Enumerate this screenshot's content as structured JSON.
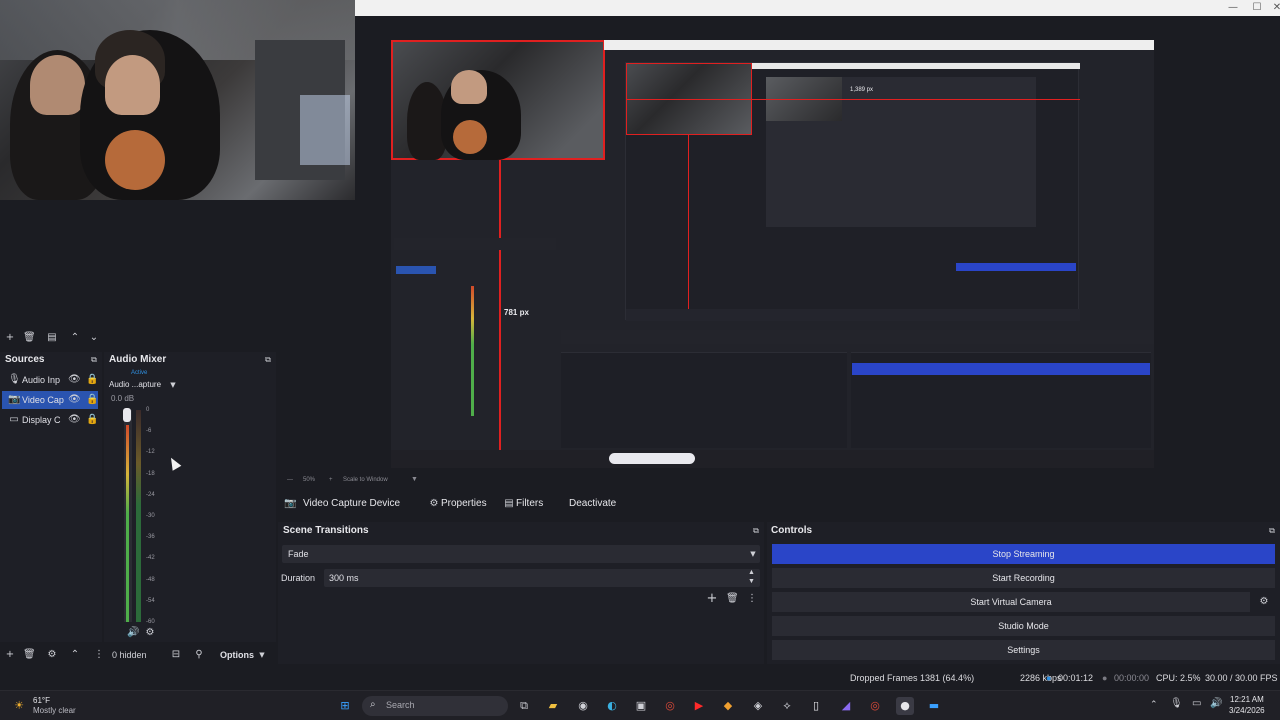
{
  "window": {
    "min": "—",
    "max": "☐",
    "close": "✕"
  },
  "sources": {
    "title": "Sources",
    "items": [
      {
        "label": "Audio Inp",
        "icon": "mic-icon"
      },
      {
        "label": "Video Cap",
        "icon": "camera-icon",
        "selected": true
      },
      {
        "label": "Display C",
        "icon": "monitor-icon"
      }
    ]
  },
  "mixer": {
    "title": "Audio Mixer",
    "channel_status": "Active",
    "channel_name": "Audio ...apture",
    "db": "0.0 dB",
    "ticks": [
      "0",
      "-6",
      "-12",
      "-18",
      "-24",
      "-30",
      "-36",
      "-42",
      "-48",
      "-54",
      "-60"
    ],
    "level": 0.93,
    "hidden": "0 hidden",
    "options": "Options"
  },
  "preview": {
    "measure": "781 px",
    "inner_measure": "1,389 px"
  },
  "zoom_bar": {
    "zoom": "50%",
    "scale": "Scale to Window"
  },
  "toolbar": {
    "source_name": "Video Capture Device",
    "properties": "Properties",
    "filters": "Filters",
    "deactivate": "Deactivate"
  },
  "transitions": {
    "title": "Scene Transitions",
    "selected": "Fade",
    "duration_label": "Duration",
    "duration_value": "300 ms"
  },
  "controls": {
    "title": "Controls",
    "buttons": [
      "Stop Streaming",
      "Start Recording",
      "Start Virtual Camera",
      "Studio Mode",
      "Settings"
    ]
  },
  "status": {
    "dropped": "Dropped Frames 1381 (64.4%)",
    "bitrate": "2286 kbps",
    "stream_time": "00:01:12",
    "rec_time": "00:00:00",
    "cpu": "CPU: 2.5%",
    "fps": "30.00 / 30.00 FPS"
  },
  "taskbar": {
    "weather_temp": "61°F",
    "weather_desc": "Mostly clear",
    "search_placeholder": "Search",
    "time": "12:21 AM",
    "date": "3/24/2026"
  },
  "colors": {
    "accent": "#2a45c8",
    "selection": "#2a54b0",
    "guide": "#e02020"
  }
}
